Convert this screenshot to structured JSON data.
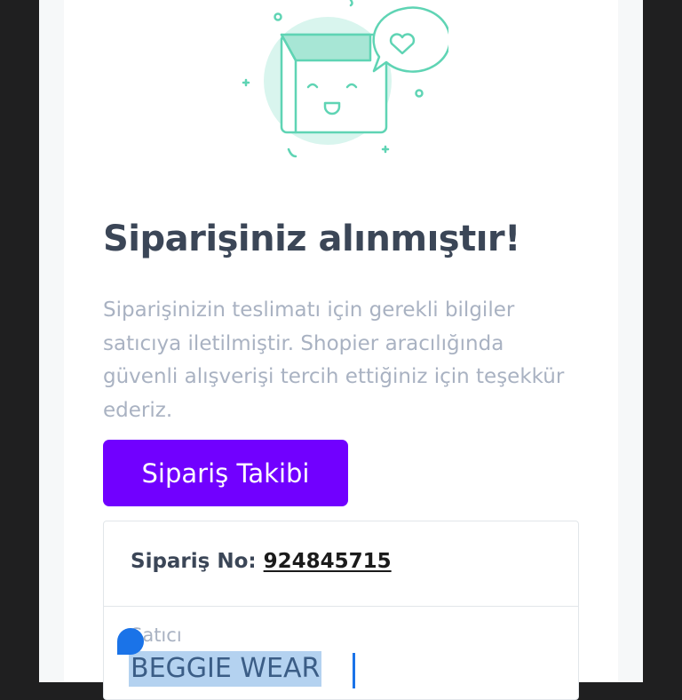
{
  "order_confirmation": {
    "title": "Siparişiniz alınmıştır!",
    "description": "Siparişinizin teslimatı için gerekli bilgiler satıcıya iletilmiştir. Shopier aracılığında güvenli alışverişi tercih ettiğiniz için teşekkür ederiz.",
    "track_button_label": "Sipariş Takibi",
    "order_number_label": "Sipariş No:",
    "order_number": "924845715",
    "seller_label": "Satıcı",
    "seller_name": "BEGGIE WEAR"
  },
  "colors": {
    "primary_button": "#7100ff",
    "title_text": "#3b4657",
    "muted_text": "#a9b2c2",
    "illustration_stroke": "#5fd4b4",
    "illustration_fill": "#d9f5ee",
    "selection_highlight": "#b4d2f0",
    "selection_handle": "#1a73e8"
  },
  "icons": {
    "illustration": "happy-shopping-bag-icon",
    "speech_bubble": "heart-speech-bubble-icon"
  }
}
